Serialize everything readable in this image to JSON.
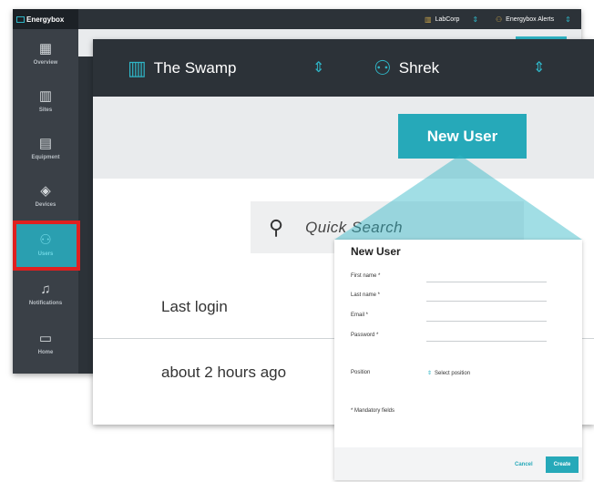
{
  "app": {
    "brand": "Energybox",
    "topbar": {
      "org": "LabCorp",
      "alerts": "Energybox Alerts"
    },
    "sidebar": {
      "items": [
        {
          "label": "Overview",
          "icon": "grid-icon",
          "glyph": "▦"
        },
        {
          "label": "Sites",
          "icon": "building-icon",
          "glyph": "▥"
        },
        {
          "label": "Equipment",
          "icon": "equipment-icon",
          "glyph": "▤"
        },
        {
          "label": "Devices",
          "icon": "devices-icon",
          "glyph": "◈"
        },
        {
          "label": "Users",
          "icon": "user-icon",
          "glyph": "⚇"
        },
        {
          "label": "Notifications",
          "icon": "bell-icon",
          "glyph": "♫"
        },
        {
          "label": "Home",
          "icon": "monitor-icon",
          "glyph": "▭"
        }
      ],
      "active": "Users"
    }
  },
  "zoom": {
    "site_name": "The Swamp",
    "user_name": "Shrek",
    "new_user_button": "New User",
    "search_placeholder": "Quick Search",
    "last_login_label": "Last login",
    "last_login_value": "about 2 hours ago"
  },
  "dialog": {
    "title": "New User",
    "fields": [
      {
        "label": "First name *"
      },
      {
        "label": "Last name *"
      },
      {
        "label": "Email *"
      },
      {
        "label": "Password *"
      }
    ],
    "position_label": "Position",
    "position_placeholder": "Select position",
    "mandatory_note": "* Mandatory fields",
    "cancel_label": "Cancel",
    "create_label": "Create"
  },
  "colors": {
    "accent": "#26a9b9",
    "dark": "#2c3238",
    "highlight": "#e0201f"
  }
}
